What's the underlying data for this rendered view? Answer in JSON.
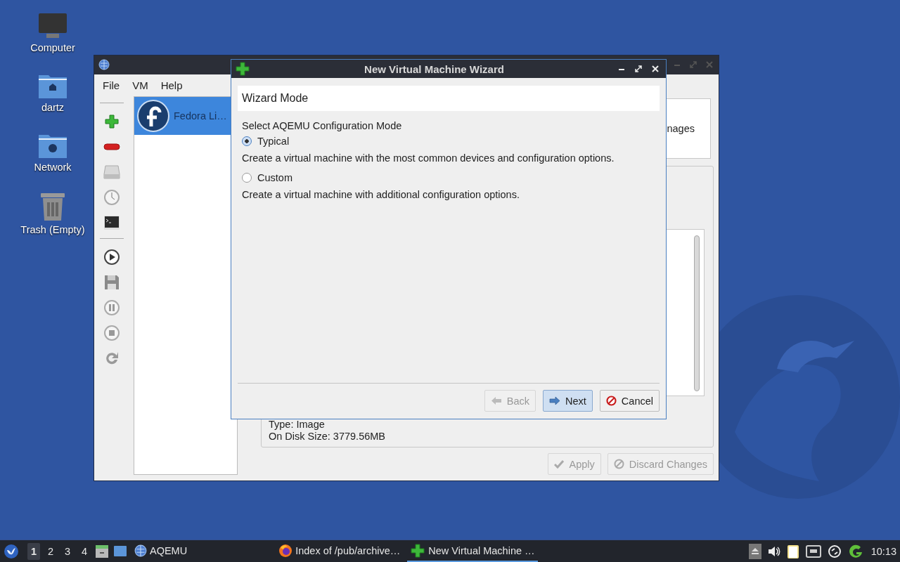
{
  "desktop_icons": [
    {
      "label": "Computer",
      "kind": "computer"
    },
    {
      "label": "dartz",
      "kind": "home"
    },
    {
      "label": "Network",
      "kind": "network"
    },
    {
      "label": "Trash (Empty)",
      "kind": "trash"
    }
  ],
  "main_window": {
    "menu": [
      "File",
      "VM",
      "Help"
    ],
    "toolbar": [
      {
        "kind": "separator"
      },
      {
        "kind": "add"
      },
      {
        "kind": "remove"
      },
      {
        "kind": "disk"
      },
      {
        "kind": "clock"
      },
      {
        "kind": "terminal"
      },
      {
        "kind": "separator"
      },
      {
        "kind": "play"
      },
      {
        "kind": "save"
      },
      {
        "kind": "pause"
      },
      {
        "kind": "stop"
      },
      {
        "kind": "reload"
      }
    ],
    "vm_list": [
      {
        "name": "Fedora Li…",
        "selected": true
      }
    ],
    "top_panel_text": "nages",
    "details": [
      "Type: Image",
      "On Disk Size: 3779.56MB"
    ],
    "buttons": [
      {
        "label": "Apply",
        "kind": "apply",
        "disabled": true
      },
      {
        "label": "Discard Changes",
        "kind": "discard",
        "disabled": true
      }
    ]
  },
  "dialog": {
    "title": "New Virtual Machine Wizard",
    "header": "Wizard Mode",
    "prompt": "Select AQEMU Configuration Mode",
    "options": [
      {
        "label": "Typical",
        "description": "Create a virtual machine with the most common devices and configuration options.",
        "selected": true
      },
      {
        "label": "Custom",
        "description": "Create a virtual machine with additional configuration options.",
        "selected": false
      }
    ],
    "buttons": [
      {
        "label": "Back",
        "kind": "back",
        "disabled": true,
        "default": false
      },
      {
        "label": "Next",
        "kind": "next",
        "disabled": false,
        "default": true
      },
      {
        "label": "Cancel",
        "kind": "cancel",
        "disabled": false,
        "default": false
      }
    ]
  },
  "taskbar": {
    "workspaces": [
      {
        "label": "1",
        "selected": true
      },
      {
        "label": "2",
        "selected": false
      },
      {
        "label": "3",
        "selected": false
      },
      {
        "label": "4",
        "selected": false
      }
    ],
    "tasks": [
      {
        "label": "AQEMU",
        "kind": "aqemu",
        "active": false
      },
      {
        "label": "Index of /pub/archive…",
        "kind": "firefox",
        "active": false
      },
      {
        "label": "New Virtual Machine …",
        "kind": "wizard",
        "active": true
      }
    ],
    "clock": "10:13"
  }
}
